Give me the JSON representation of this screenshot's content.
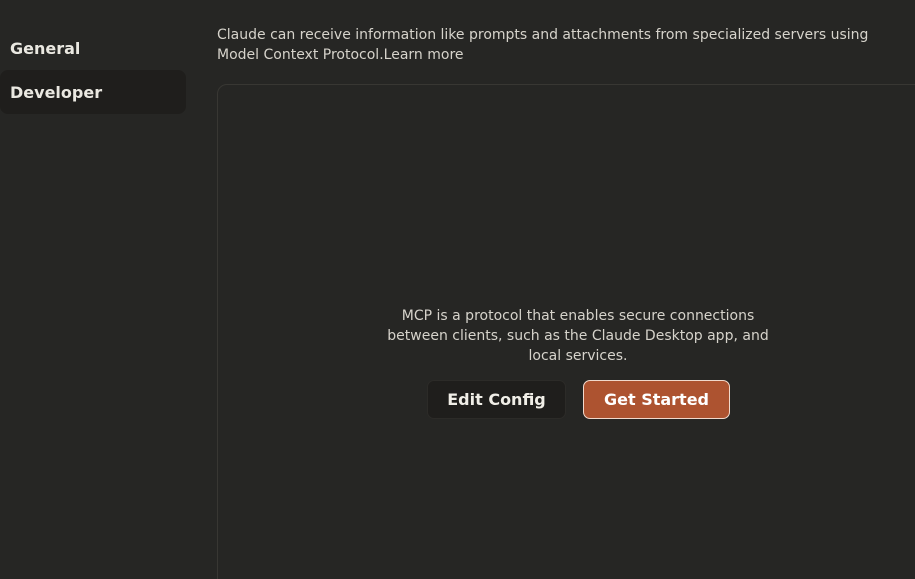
{
  "sidebar": {
    "items": [
      {
        "label": "General",
        "active": false
      },
      {
        "label": "Developer",
        "active": true
      }
    ]
  },
  "main": {
    "description": "Claude can receive information like prompts and attachments from specialized servers using Model Context Protocol.",
    "learn_more_label": "Learn more",
    "empty_state": {
      "text": "MCP is a protocol that enables secure connections between clients, such as the Claude Desktop app, and local services.",
      "edit_config_label": "Edit Config",
      "get_started_label": "Get Started"
    }
  },
  "colors": {
    "background": "#262624",
    "sidebar_active": "#1f1e1c",
    "accent": "#ad5330",
    "text": "#e8e6df"
  }
}
